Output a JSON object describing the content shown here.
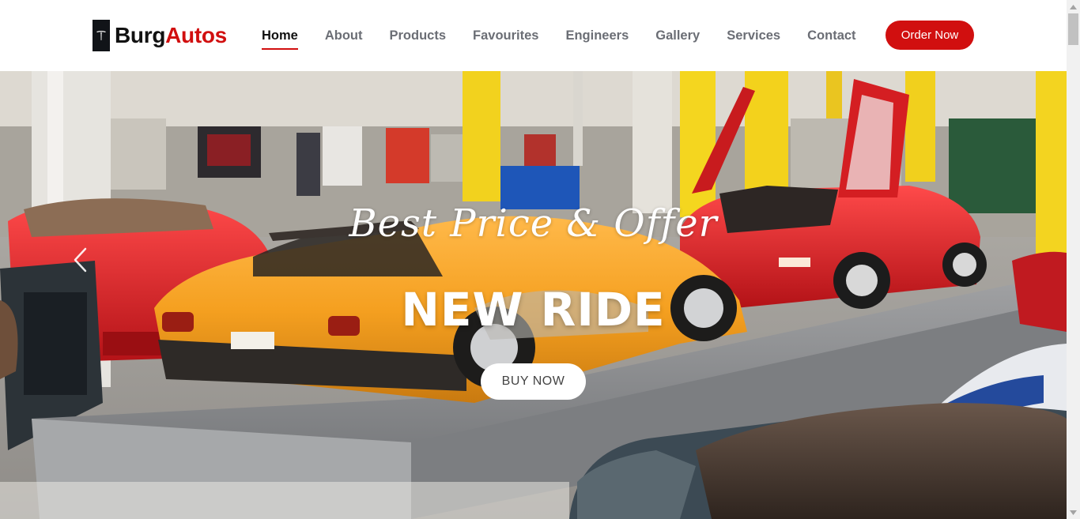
{
  "brand": {
    "name_part1": "Burg",
    "name_part2": "Autos",
    "icon": "tesla-logo-icon",
    "dark_color": "#111111",
    "accent_color": "#d10f0f"
  },
  "nav": {
    "items": [
      {
        "label": "Home",
        "active": true
      },
      {
        "label": "About",
        "active": false
      },
      {
        "label": "Products",
        "active": false
      },
      {
        "label": "Favourites",
        "active": false
      },
      {
        "label": "Engineers",
        "active": false
      },
      {
        "label": "Gallery",
        "active": false
      },
      {
        "label": "Services",
        "active": false
      },
      {
        "label": "Contact",
        "active": false
      }
    ],
    "cta_label": "Order Now"
  },
  "hero": {
    "subtitle": "Best Price & Offer",
    "title": "NEW RIDE",
    "button_label": "BUY NOW",
    "prev_icon": "chevron-left-icon"
  }
}
